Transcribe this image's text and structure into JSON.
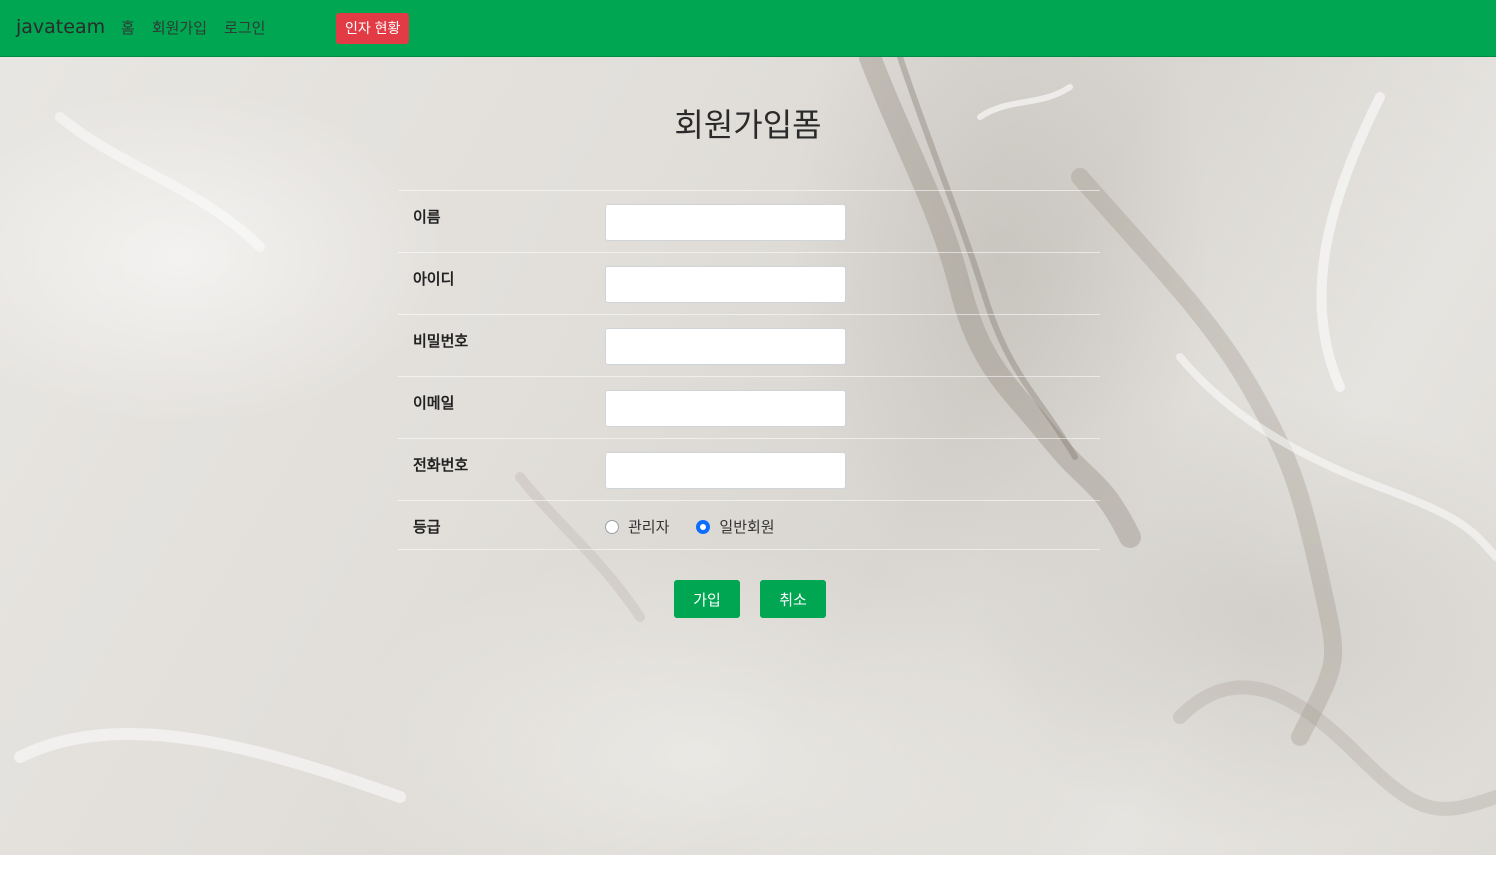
{
  "navbar": {
    "brand": "javateam",
    "links": [
      "홈",
      "회원가입",
      "로그인"
    ],
    "status_button": "인자 현황",
    "colors": {
      "background": "#00a651",
      "status_button": "#e23b45"
    }
  },
  "form": {
    "title": "회원가입폼",
    "fields": [
      {
        "label": "이름",
        "value": ""
      },
      {
        "label": "아이디",
        "value": ""
      },
      {
        "label": "비밀번호",
        "value": ""
      },
      {
        "label": "이메일",
        "value": ""
      },
      {
        "label": "전화번호",
        "value": ""
      }
    ],
    "grade": {
      "label": "등급",
      "options": [
        "관리자",
        "일반회원"
      ],
      "selected": "일반회원"
    },
    "buttons": {
      "submit": "가입",
      "cancel": "취소"
    }
  }
}
